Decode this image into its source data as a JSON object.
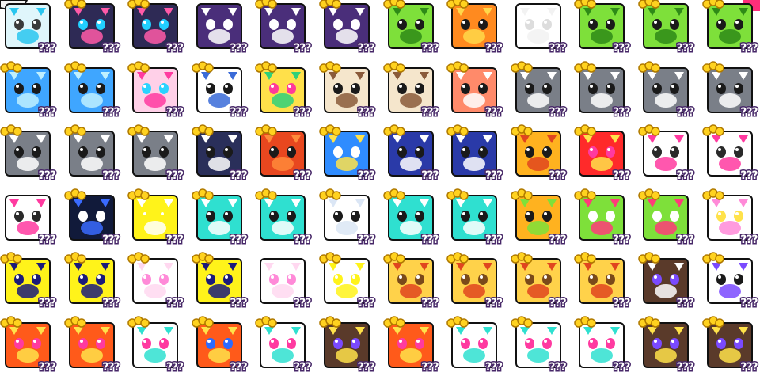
{
  "grid": {
    "columns": 12,
    "rows": 6,
    "tiles": [
      {
        "label": "???",
        "bg": "#dff6fb",
        "accent": "#29c6ef",
        "eye": "#3a3a3a",
        "stars": false
      },
      {
        "label": "???",
        "bg": "#2e2a55",
        "accent": "#ff5aa8",
        "eye": "#22d0ff",
        "stars": true
      },
      {
        "label": "???",
        "bg": "#2e2a55",
        "accent": "#ff5aa8",
        "eye": "#22d0ff",
        "stars": true
      },
      {
        "label": "???",
        "bg": "#4a2e7a",
        "accent": "#ffffff",
        "eye": "#ffffff",
        "stars": false
      },
      {
        "label": "???",
        "bg": "#4a2e7a",
        "accent": "#ffffff",
        "eye": "#ffffff",
        "stars": true
      },
      {
        "label": "???",
        "bg": "#4a2e7a",
        "accent": "#ffffff",
        "eye": "#ffffff",
        "stars": true
      },
      {
        "label": "???",
        "bg": "#7ee03a",
        "accent": "#2e8a17",
        "eye": "#1a1a1a",
        "stars": true
      },
      {
        "label": "???",
        "bg": "#ff8a1f",
        "accent": "#ffd84a",
        "eye": "#1a1a1a",
        "stars": true
      },
      {
        "label": "???",
        "bg": "#ffffff",
        "accent": "#f2f2f2",
        "eye": "#dddddd",
        "stars": false
      },
      {
        "label": "???",
        "bg": "#7ee03a",
        "accent": "#2e8a17",
        "eye": "#1a1a1a",
        "stars": true
      },
      {
        "label": "???",
        "bg": "#7ee03a",
        "accent": "#2e8a17",
        "eye": "#1a1a1a",
        "stars": true
      },
      {
        "label": "???",
        "bg": "#7ee03a",
        "accent": "#2e8a17",
        "eye": "#1a1a1a",
        "stars": true
      },
      {
        "label": "???",
        "bg": "#3fa6ff",
        "accent": "#bff0ff",
        "eye": "#1a1a1a",
        "stars": true
      },
      {
        "label": "???",
        "bg": "#3fa6ff",
        "accent": "#bff0ff",
        "eye": "#1a1a1a",
        "stars": true
      },
      {
        "label": "???",
        "bg": "#ffd0e8",
        "accent": "#ff3aa0",
        "eye": "#2ad3ff",
        "stars": true
      },
      {
        "label": "???",
        "bg": "#ffffff",
        "accent": "#3a6bd8",
        "eye": "#1a1a1a",
        "stars": true
      },
      {
        "label": "???",
        "bg": "#ffe04a",
        "accent": "#2fd07a",
        "eye": "#ff3a9a",
        "stars": true
      },
      {
        "label": "???",
        "bg": "#f5e6cc",
        "accent": "#8a5a3a",
        "eye": "#1a1a1a",
        "stars": true
      },
      {
        "label": "???",
        "bg": "#f5e6cc",
        "accent": "#8a5a3a",
        "eye": "#1a1a1a",
        "stars": true
      },
      {
        "label": "???",
        "bg": "#ff8a6a",
        "accent": "#ffffff",
        "eye": "#1a1a1a",
        "stars": true
      },
      {
        "label": "???",
        "bg": "#7a7f88",
        "accent": "#ffffff",
        "eye": "#1a1a1a",
        "stars": true
      },
      {
        "label": "???",
        "bg": "#7a7f88",
        "accent": "#ffffff",
        "eye": "#1a1a1a",
        "stars": true
      },
      {
        "label": "???",
        "bg": "#7a7f88",
        "accent": "#ffffff",
        "eye": "#1a1a1a",
        "stars": true
      },
      {
        "label": "???",
        "bg": "#7a7f88",
        "accent": "#ffffff",
        "eye": "#1a1a1a",
        "stars": true
      },
      {
        "label": "???",
        "bg": "#7a7f88",
        "accent": "#ffffff",
        "eye": "#1a1a1a",
        "stars": true
      },
      {
        "label": "???",
        "bg": "#7a7f88",
        "accent": "#ffffff",
        "eye": "#1a1a1a",
        "stars": true
      },
      {
        "label": "???",
        "bg": "#7a7f88",
        "accent": "#ffffff",
        "eye": "#1a1a1a",
        "stars": true
      },
      {
        "label": "???",
        "bg": "#2a2f5a",
        "accent": "#ffffff",
        "eye": "#1a1a1a",
        "stars": true
      },
      {
        "label": "???",
        "bg": "#e8471f",
        "accent": "#ff8a3a",
        "eye": "#1a1a1a",
        "stars": true
      },
      {
        "label": "???",
        "bg": "#2f8cff",
        "accent": "#ffe24a",
        "eye": "#ffffff",
        "stars": true
      },
      {
        "label": "???",
        "bg": "#2a3aa8",
        "accent": "#ffffff",
        "eye": "#1a1a1a",
        "stars": true
      },
      {
        "label": "???",
        "bg": "#2a3aa8",
        "accent": "#ffffff",
        "eye": "#1a1a1a",
        "stars": true
      },
      {
        "label": "???",
        "bg": "#ffb21f",
        "accent": "#e0451f",
        "eye": "#1a1a1a",
        "stars": true
      },
      {
        "label": "???",
        "bg": "#ff2a2a",
        "accent": "#ffe24a",
        "eye": "#ff3aa0",
        "stars": true
      },
      {
        "label": "???",
        "bg": "#ffffff",
        "accent": "#ff3aa0",
        "eye": "#2a2a2a",
        "stars": true
      },
      {
        "label": "???",
        "bg": "#ffffff",
        "accent": "#ff3aa0",
        "eye": "#2a2a2a",
        "stars": true
      },
      {
        "label": "???",
        "bg": "#ffffff",
        "accent": "#ff3aa0",
        "eye": "#2a2a2a",
        "stars": false
      },
      {
        "label": "???",
        "bg": "#111a3a",
        "accent": "#3a6bff",
        "eye": "#ffffff",
        "stars": true
      },
      {
        "label": "???",
        "bg": "#fff31a",
        "accent": "#ffffff",
        "eye": "#fff31a",
        "stars": true
      },
      {
        "label": "???",
        "bg": "#2fe0d0",
        "accent": "#ffffff",
        "eye": "#1a1a1a",
        "stars": true
      },
      {
        "label": "???",
        "bg": "#2fe0d0",
        "accent": "#ffffff",
        "eye": "#1a1a1a",
        "stars": true
      },
      {
        "label": "???",
        "bg": "#ffffff",
        "accent": "#dbe6f5",
        "eye": "#1a1a1a",
        "stars": true
      },
      {
        "label": "???",
        "bg": "#2fe0d0",
        "accent": "#ffffff",
        "eye": "#1a1a1a",
        "stars": true
      },
      {
        "label": "???",
        "bg": "#2fe0d0",
        "accent": "#ffffff",
        "eye": "#1a1a1a",
        "stars": true
      },
      {
        "label": "???",
        "bg": "#ffb21f",
        "accent": "#7ee03a",
        "eye": "#1a1a1a",
        "stars": true
      },
      {
        "label": "???",
        "bg": "#7ee03a",
        "accent": "#ff3a7a",
        "eye": "#ffffff",
        "stars": true
      },
      {
        "label": "???",
        "bg": "#7ee03a",
        "accent": "#ff3a7a",
        "eye": "#ffffff",
        "stars": true
      },
      {
        "label": "???",
        "bg": "#ffffff",
        "accent": "#ff8ad8",
        "eye": "#ffe24a",
        "stars": true
      },
      {
        "label": "???",
        "bg": "#fff31a",
        "accent": "#1a1a7a",
        "eye": "#1a1a7a",
        "stars": true
      },
      {
        "label": "???",
        "bg": "#fff31a",
        "accent": "#1a1a7a",
        "eye": "#1a1a7a",
        "stars": true
      },
      {
        "label": "???",
        "bg": "#ffffff",
        "accent": "#ffd8f0",
        "eye": "#ff8ad8",
        "stars": true
      },
      {
        "label": "???",
        "bg": "#fff31a",
        "accent": "#1a1a7a",
        "eye": "#1a1a7a",
        "stars": true
      },
      {
        "label": "???",
        "bg": "#ffffff",
        "accent": "#ffd8f0",
        "eye": "#ff8ad8",
        "stars": false
      },
      {
        "label": "???",
        "bg": "#ffffff",
        "accent": "#fff31a",
        "eye": "#fff31a",
        "stars": true
      },
      {
        "label": "???",
        "bg": "#ffd24a",
        "accent": "#e0451f",
        "eye": "#7a4a1a",
        "stars": true
      },
      {
        "label": "???",
        "bg": "#ffd24a",
        "accent": "#e0451f",
        "eye": "#7a4a1a",
        "stars": true
      },
      {
        "label": "???",
        "bg": "#ffd24a",
        "accent": "#e0451f",
        "eye": "#7a4a1a",
        "stars": true
      },
      {
        "label": "???",
        "bg": "#ffd24a",
        "accent": "#e0451f",
        "eye": "#7a4a1a",
        "stars": true
      },
      {
        "label": "???",
        "bg": "#5a3a2a",
        "accent": "#ffffff",
        "eye": "#7a4aff",
        "stars": true
      },
      {
        "label": "???",
        "bg": "#ffffff",
        "accent": "#7a4aff",
        "eye": "#1a1a1a",
        "stars": true
      },
      {
        "label": "???",
        "bg": "#ff5a1a",
        "accent": "#ffe24a",
        "eye": "#ff3aa0",
        "stars": true
      },
      {
        "label": "???",
        "bg": "#ff5a1a",
        "accent": "#ffe24a",
        "eye": "#ff3aa0",
        "stars": true
      },
      {
        "label": "???",
        "bg": "#ffffff",
        "accent": "#2fe0d0",
        "eye": "#ff3aa0",
        "stars": true
      },
      {
        "label": "???",
        "bg": "#ff5a1a",
        "accent": "#ffe24a",
        "eye": "#2a6bff",
        "stars": true
      },
      {
        "label": "???",
        "bg": "#ffffff",
        "accent": "#2fe0d0",
        "eye": "#ff3aa0",
        "stars": true
      },
      {
        "label": "???",
        "bg": "#5a3a2a",
        "accent": "#ffe24a",
        "eye": "#7a4aff",
        "stars": true
      },
      {
        "label": "???",
        "bg": "#ff5a1a",
        "accent": "#ffe24a",
        "eye": "#ff3aa0",
        "stars": true
      },
      {
        "label": "???",
        "bg": "#ffffff",
        "accent": "#2fe0d0",
        "eye": "#ff3aa0",
        "stars": true
      },
      {
        "label": "???",
        "bg": "#ffffff",
        "accent": "#2fe0d0",
        "eye": "#ff3aa0",
        "stars": true
      },
      {
        "label": "???",
        "bg": "#ffffff",
        "accent": "#2fe0d0",
        "eye": "#ff3aa0",
        "stars": true
      },
      {
        "label": "???",
        "bg": "#5a3a2a",
        "accent": "#ffe24a",
        "eye": "#7a4aff",
        "stars": true
      },
      {
        "label": "???",
        "bg": "#5a3a2a",
        "accent": "#ffe24a",
        "eye": "#7a4aff",
        "stars": true
      }
    ]
  },
  "colors": {
    "star": "#ffd21f",
    "star_stroke": "#b07a00",
    "label_stroke": "#4a2a6c",
    "corner_badge": "#ff2e7a"
  }
}
